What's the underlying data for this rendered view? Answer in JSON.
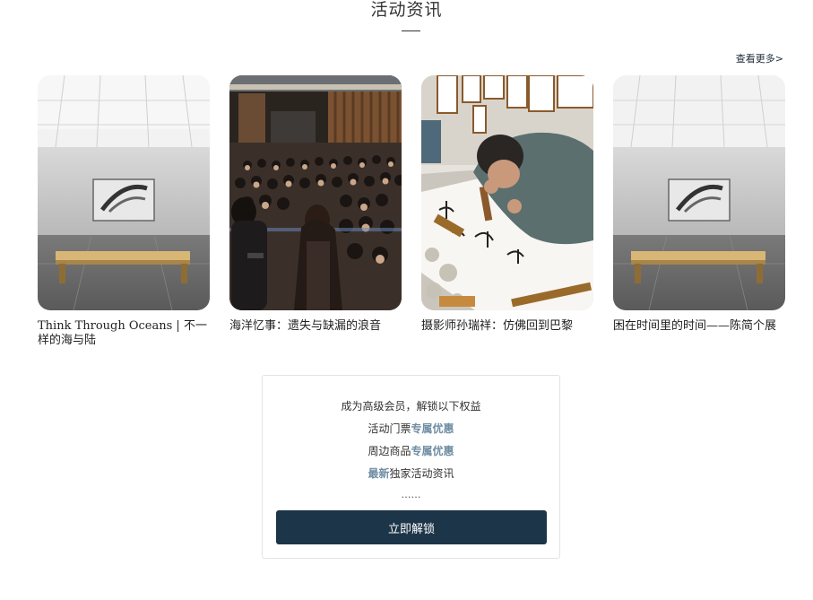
{
  "section": {
    "title": "活动资讯",
    "more_label": "查看更多>"
  },
  "cards": [
    {
      "title": "Think Through Oceans | 不一样的海与陆",
      "image": "gallery-bench-artwork"
    },
    {
      "title": "海洋忆事：遗失与缺漏的浪音",
      "image": "auditorium-audience-speaker"
    },
    {
      "title": "摄影师孙瑞祥：仿佛回到巴黎",
      "image": "calligraphy-artist-writing"
    },
    {
      "title": "困在时间里的时间——陈简个展",
      "image": "gallery-bench-artwork"
    }
  ],
  "membership": {
    "headline": "成为高级会员，解锁以下权益",
    "benefits": [
      {
        "prefix": "活动门票",
        "highlight": "专属优惠",
        "suffix": ""
      },
      {
        "prefix": "周边商品",
        "highlight": "专属优惠",
        "suffix": ""
      },
      {
        "prefix": "",
        "highlight": "最新",
        "suffix": "独家活动资讯"
      }
    ],
    "ellipsis": "……",
    "button_label": "立即解锁"
  },
  "colors": {
    "button_bg": "#1d3548",
    "highlight": "#6f8ea3"
  }
}
